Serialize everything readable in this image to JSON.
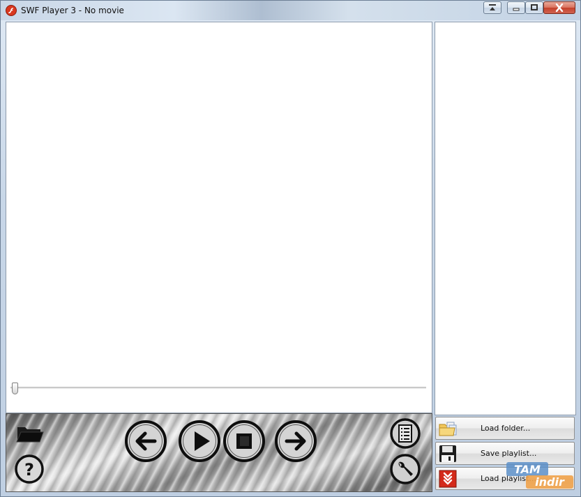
{
  "window": {
    "title": "SWF Player 3 - No movie",
    "title_buttons": [
      "restore-down-icon",
      "minimize-icon",
      "maximize-icon",
      "close-icon"
    ]
  },
  "seekbar": {
    "position": 0
  },
  "controls": {
    "left": [
      "open-folder-icon",
      "help-icon"
    ],
    "transport": [
      "previous-icon",
      "play-icon",
      "stop-icon",
      "next-icon"
    ],
    "right": [
      "playlist-icon",
      "settings-wrench-icon"
    ]
  },
  "playlist": {
    "items": [],
    "buttons": [
      {
        "label": "Load folder...",
        "icon": "folder-files-icon"
      },
      {
        "label": "Save playlist...",
        "icon": "floppy-disk-icon"
      },
      {
        "label": "Load playlist...",
        "icon": "load-arrows-icon"
      }
    ]
  },
  "watermark": {
    "line1": "TAM",
    "line2": "indir"
  },
  "colors": {
    "accent_red": "#d9371f",
    "title_bar": "#c9d7e7",
    "panel_metal": "#a9a9a9"
  }
}
